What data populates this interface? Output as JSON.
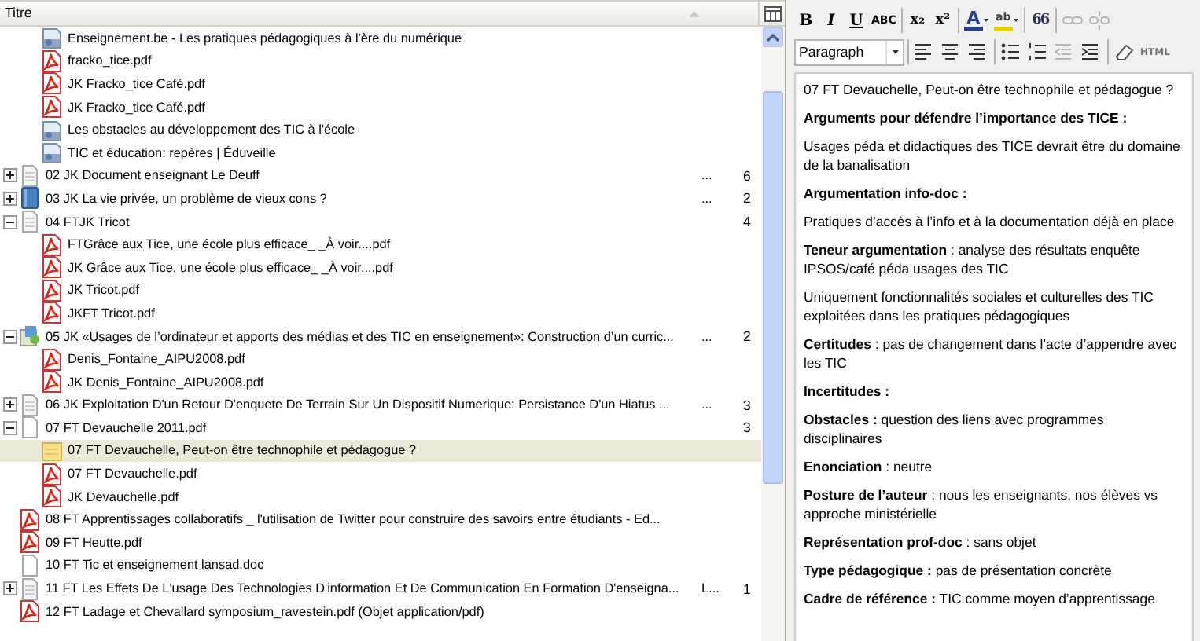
{
  "list_header": {
    "columns": [
      {
        "label": "Titre"
      }
    ]
  },
  "tree": {
    "continued_children": [
      {
        "label": "Enseignement.be - Les pratiques pédagogiques à l'ère du numérique",
        "kind": "web",
        "selected": false
      },
      {
        "label": "fracko_tice.pdf",
        "kind": "pdf",
        "selected": false
      },
      {
        "label": "JK Fracko_tice Café.pdf",
        "kind": "pdf",
        "selected": false
      },
      {
        "label": "JK Fracko_tice Café.pdf",
        "kind": "pdf",
        "selected": false
      },
      {
        "label": "Les obstacles au développement des TIC à l'école",
        "kind": "web",
        "selected": false
      },
      {
        "label": "TIC et éducation: repères | Éduveille",
        "kind": "web",
        "selected": false
      }
    ],
    "items": [
      {
        "label": "02 JK Document enseignant Le Deuff",
        "kind": "doc",
        "expanded": false,
        "selected": false,
        "column_2": "...",
        "column_3": "6"
      },
      {
        "label": "03 JK La vie privée, un problème de vieux cons ?",
        "kind": "book",
        "expanded": false,
        "selected": false,
        "column_2": "...",
        "column_3": "2"
      },
      {
        "label": "04 FTJK Tricot",
        "kind": "doc",
        "expanded": true,
        "selected": false,
        "column_3": "4",
        "children": [
          {
            "label": "FTGrâce aux Tice, une école plus efficace_ _À voir....pdf",
            "kind": "pdf",
            "selected": false
          },
          {
            "label": "JK Grâce aux Tice, une école plus efficace_ _À voir....pdf",
            "kind": "pdf",
            "selected": false
          },
          {
            "label": "JK Tricot.pdf",
            "kind": "pdf",
            "selected": false
          },
          {
            "label": "JKFT Tricot.pdf",
            "kind": "pdf",
            "selected": false
          }
        ]
      },
      {
        "label": "05 JK «Usages de l’ordinateur et apports des médias et des TIC en enseignement»: Construction d’un curric...",
        "kind": "section",
        "expanded": true,
        "selected": false,
        "column_2": "...",
        "column_3": "2",
        "children": [
          {
            "label": "Denis_Fontaine_AIPU2008.pdf",
            "kind": "pdf",
            "selected": false
          },
          {
            "label": "JK Denis_Fontaine_AIPU2008.pdf",
            "kind": "pdf",
            "selected": false
          }
        ]
      },
      {
        "label": "06 JK  Exploitation D'un Retour D'enquete De Terrain Sur Un Dispositif Numerique: Persistance D'un Hiatus ...",
        "kind": "doc",
        "expanded": false,
        "selected": false,
        "column_2": "...",
        "column_3": "3"
      },
      {
        "label": "07 FT Devauchelle 2011.pdf",
        "kind": "blank",
        "expanded": true,
        "selected": false,
        "column_3": "3",
        "children": [
          {
            "label": "07 FT Devauchelle, Peut-on être technophile et pédagogue ?",
            "kind": "note",
            "selected": true
          },
          {
            "label": "07 FT Devauchelle.pdf",
            "kind": "pdf",
            "selected": false
          },
          {
            "label": "JK Devauchelle.pdf",
            "kind": "pdf",
            "selected": false
          }
        ]
      },
      {
        "label": "08 FT Apprentissages collaboratifs _ l'utilisation de Twitter pour construire des savoirs entre étudiants - Ed...",
        "kind": "pdf",
        "selected": false
      },
      {
        "label": "09 FT Heutte.pdf",
        "kind": "pdf",
        "selected": false
      },
      {
        "label": "10 FT Tic et enseignement lansad.doc",
        "kind": "blank",
        "selected": false
      },
      {
        "label": "11 FT Les Effets De L'usage Des Technologies D'information Et De Communication En Formation D'enseigna...",
        "kind": "doc",
        "expanded": false,
        "selected": false,
        "column_2": "L...",
        "column_3": "1"
      },
      {
        "label": "12 FT Ladage et Chevallard symposium_ravestein.pdf (Objet application/pdf)",
        "kind": "pdf",
        "selected": false
      }
    ]
  },
  "toolbar": {
    "row_1": [
      {
        "kind": "bold",
        "label": "B"
      },
      {
        "kind": "italic",
        "label": "I"
      },
      {
        "kind": "underline",
        "label": "U"
      },
      {
        "kind": "strike",
        "label": "ABC"
      },
      {
        "kind": "sep"
      },
      {
        "kind": "sub",
        "label": "x₂"
      },
      {
        "kind": "sup",
        "label": "x²"
      },
      {
        "kind": "sep"
      },
      {
        "kind": "textcolor",
        "label": "A"
      },
      {
        "kind": "highlight",
        "label": "ab"
      },
      {
        "kind": "sep"
      },
      {
        "kind": "quote",
        "label": "66"
      },
      {
        "kind": "sep"
      },
      {
        "kind": "link",
        "disabled": true
      },
      {
        "kind": "unlink",
        "disabled": true
      }
    ],
    "format_select": {
      "value": "Paragraph"
    },
    "row_2": [
      {
        "kind": "sep"
      },
      {
        "kind": "align-left"
      },
      {
        "kind": "align-center"
      },
      {
        "kind": "align-right"
      },
      {
        "kind": "sep"
      },
      {
        "kind": "bullets"
      },
      {
        "kind": "numbers"
      },
      {
        "kind": "outdent",
        "disabled": true
      },
      {
        "kind": "indent"
      },
      {
        "kind": "sep"
      },
      {
        "kind": "eraser"
      },
      {
        "kind": "html",
        "label": "HTML"
      }
    ]
  },
  "editor": {
    "paragraphs": [
      "07 FT Devauchelle, Peut-on être technophile et pédagogue ?",
      "**Arguments pour défendre l’importance des TICE :**",
      "Usages péda et didactiques des TICE devrait être du domaine de la banalisation",
      "**Argumentation info-doc :**",
      "Pratiques d’accès à l’info et à la documentation déjà en place",
      "**Teneur argumentation** : analyse des résultats enquête IPSOS/café péda usages des TIC",
      "Uniquement fonctionnalités sociales et culturelles des TIC exploitées dans les pratiques pédagogiques",
      "**Certitudes** : pas de changement dans l’acte d’appendre avec les TIC",
      "**Incertitudes :**",
      "**Obstacles :** question des liens avec programmes disciplinaires",
      "**Enonciation** : neutre",
      "**Posture de l’auteur** : nous les enseignants, nos élèves vs approche ministérielle",
      "**Représentation prof-doc** : sans objet",
      "**Type pédagogique :** pas de présentation concrète",
      "**Cadre de référence :** TIC comme moyen d’apprentissage"
    ]
  }
}
